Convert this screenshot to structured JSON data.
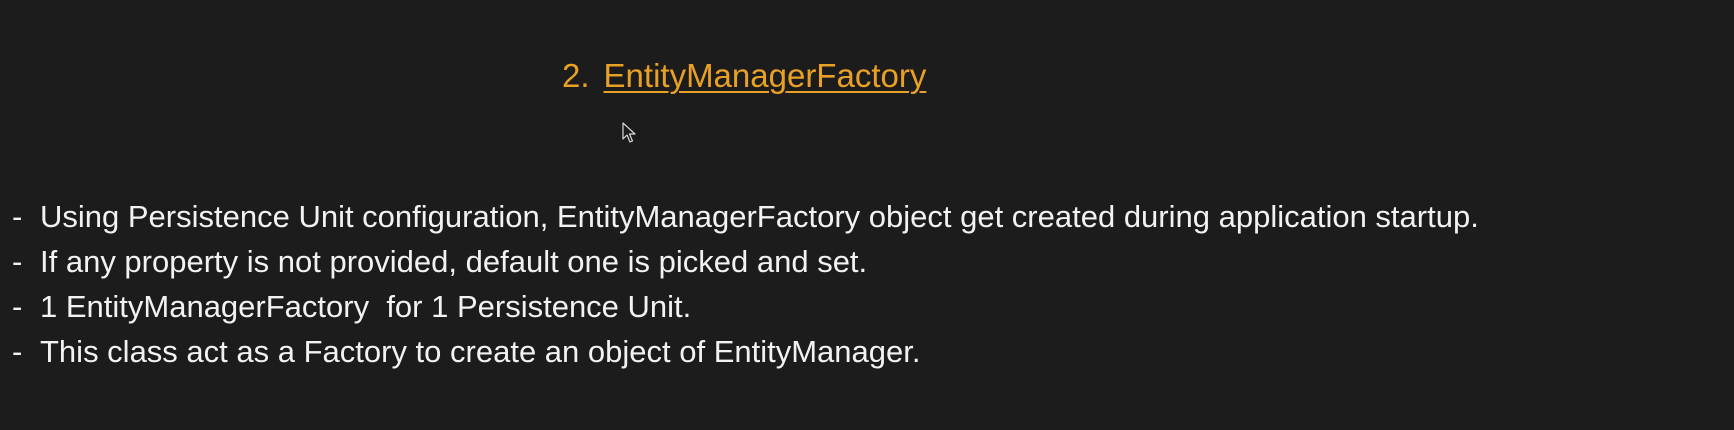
{
  "heading": {
    "number": "2.",
    "title": "EntityManagerFactory"
  },
  "bullet_marker": "-",
  "bullets": [
    "Using Persistence Unit configuration, EntityManagerFactory object get created during application startup.",
    "If any property is not provided, default one is picked and set.",
    "1 EntityManagerFactory  for 1 Persistence Unit.",
    "This class act as a Factory to create an object of EntityManager."
  ],
  "colors": {
    "background": "#1c1c1c",
    "heading": "#e8a025",
    "text": "#f2f2f2"
  },
  "icons": {
    "cursor": "mouse-pointer-icon"
  }
}
